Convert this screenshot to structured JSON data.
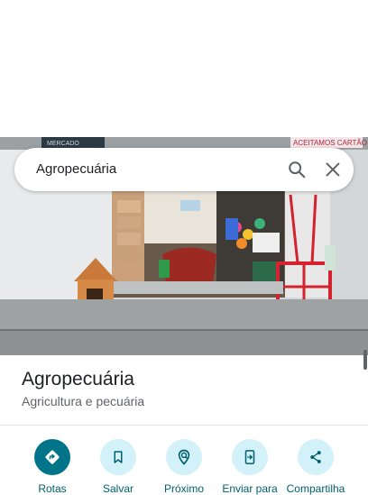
{
  "search": {
    "query": "Agropecuária"
  },
  "photo": {
    "sign_right": "ACEITAMOS CARTÃO",
    "sign_left": "MERCADO"
  },
  "place": {
    "name": "Agropecuária",
    "category": "Agricultura e pecuária"
  },
  "actions": [
    {
      "label": "Rotas",
      "icon": "directions-icon"
    },
    {
      "label": "Salvar",
      "icon": "bookmark-icon"
    },
    {
      "label": "Próximo",
      "icon": "nearby-icon"
    },
    {
      "label": "Enviar para",
      "icon": "send-to-phone-icon"
    },
    {
      "label": "Compartilha",
      "icon": "share-icon"
    }
  ],
  "colors": {
    "primary": "#00758a",
    "action_bg": "#d3f1f8",
    "action_text": "#00606f"
  }
}
